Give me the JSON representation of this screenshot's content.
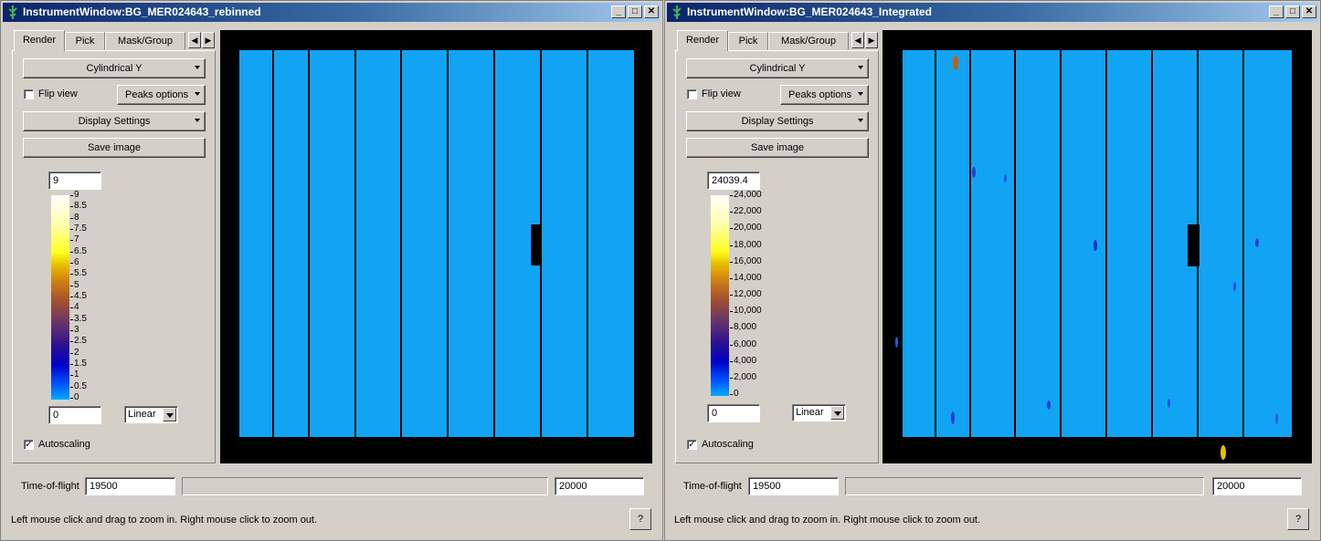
{
  "windows": [
    {
      "title": "InstrumentWindow:BG_MER024643_rebinned",
      "tabs": [
        "Render",
        "Pick",
        "Mask/Group"
      ],
      "projection": "Cylindrical Y",
      "flip_view_label": "Flip view",
      "peaks_options_label": "Peaks options",
      "display_settings_label": "Display Settings",
      "save_image_label": "Save image",
      "color_max": "9",
      "color_min": "0",
      "color_ticks": [
        "9",
        "8.5",
        "8",
        "7.5",
        "7",
        "6.5",
        "6",
        "5.5",
        "5",
        "4.5",
        "4",
        "3.5",
        "3",
        "2.5",
        "2",
        "1.5",
        "1",
        "0.5",
        "0"
      ],
      "scale_type": "Linear",
      "autoscaling_label": "Autoscaling",
      "autoscaling_checked": true,
      "tof_label": "Time-of-flight",
      "tof_min": "19500",
      "tof_max": "20000",
      "status": "Left mouse click and drag to zoom in. Right mouse click to zoom out.",
      "help_label": "?"
    },
    {
      "title": "InstrumentWindow:BG_MER024643_Integrated",
      "tabs": [
        "Render",
        "Pick",
        "Mask/Group"
      ],
      "projection": "Cylindrical Y",
      "flip_view_label": "Flip view",
      "peaks_options_label": "Peaks options",
      "display_settings_label": "Display Settings",
      "save_image_label": "Save image",
      "color_max": "24039.4",
      "color_min": "0",
      "color_ticks": [
        "24,000",
        "22,000",
        "20,000",
        "18,000",
        "16,000",
        "14,000",
        "12,000",
        "10,000",
        "8,000",
        "6,000",
        "4,000",
        "2,000",
        "0"
      ],
      "scale_type": "Linear",
      "autoscaling_label": "Autoscaling",
      "autoscaling_checked": true,
      "tof_label": "Time-of-flight",
      "tof_min": "19500",
      "tof_max": "20000",
      "status": "Left mouse click and drag to zoom in. Right mouse click to zoom out.",
      "help_label": "?"
    }
  ],
  "colors": {
    "detector_fill": "#12a4f4",
    "background": "#000000",
    "title_bar_start": "#0a246a"
  }
}
